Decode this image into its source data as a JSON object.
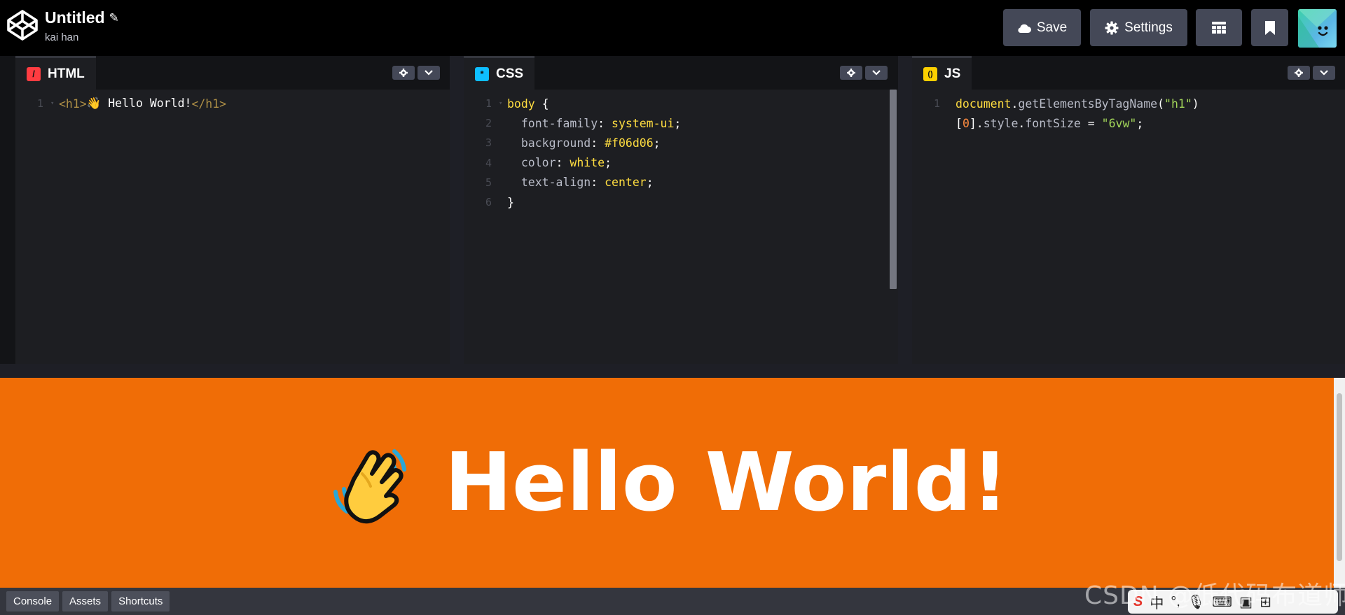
{
  "header": {
    "title": "Untitled",
    "author": "kai han",
    "save_label": "Save",
    "settings_label": "Settings"
  },
  "panes": [
    {
      "id": "html",
      "label": "HTML",
      "icon_char": "/",
      "icon_color": "#ff3c41",
      "lines": [
        {
          "n": "1",
          "fold": true,
          "tokens": [
            {
              "t": "<h1>",
              "c": "#ae8f46"
            },
            {
              "t": "👋 Hello World!",
              "c": "#ffffff"
            },
            {
              "t": "</h1>",
              "c": "#ae8f46"
            }
          ]
        }
      ]
    },
    {
      "id": "css",
      "label": "CSS",
      "icon_char": "*",
      "icon_color": "#0ebeff",
      "lines": [
        {
          "n": "1",
          "fold": true,
          "tokens": [
            {
              "t": "body ",
              "c": "#ffdd40"
            },
            {
              "t": "{",
              "c": "#ffffff"
            }
          ]
        },
        {
          "n": "2",
          "tokens": [
            {
              "t": "  font-family",
              "c": "#b9bcc8"
            },
            {
              "t": ": ",
              "c": "#ffffff"
            },
            {
              "t": "system-ui",
              "c": "#ffdd40"
            },
            {
              "t": ";",
              "c": "#ffffff"
            }
          ]
        },
        {
          "n": "3",
          "tokens": [
            {
              "t": "  background",
              "c": "#b9bcc8"
            },
            {
              "t": ": ",
              "c": "#ffffff"
            },
            {
              "t": "#f06d06",
              "c": "#ffdd40"
            },
            {
              "t": ";",
              "c": "#ffffff"
            }
          ]
        },
        {
          "n": "4",
          "tokens": [
            {
              "t": "  color",
              "c": "#b9bcc8"
            },
            {
              "t": ": ",
              "c": "#ffffff"
            },
            {
              "t": "white",
              "c": "#ffdd40"
            },
            {
              "t": ";",
              "c": "#ffffff"
            }
          ]
        },
        {
          "n": "5",
          "tokens": [
            {
              "t": "  text-align",
              "c": "#b9bcc8"
            },
            {
              "t": ": ",
              "c": "#ffffff"
            },
            {
              "t": "center",
              "c": "#ffdd40"
            },
            {
              "t": ";",
              "c": "#ffffff"
            }
          ]
        },
        {
          "n": "6",
          "tokens": [
            {
              "t": "}",
              "c": "#ffffff"
            }
          ]
        }
      ]
    },
    {
      "id": "js",
      "label": "JS",
      "icon_char": "()",
      "icon_color": "#fcd000",
      "lines": [
        {
          "n": "1",
          "tokens": [
            {
              "t": "document",
              "c": "#ffdd40"
            },
            {
              "t": ".",
              "c": "#ffffff"
            },
            {
              "t": "getElementsByTagName",
              "c": "#b9bcc8"
            },
            {
              "t": "(",
              "c": "#ffffff"
            },
            {
              "t": "\"h1\"",
              "c": "#a3d65a"
            },
            {
              "t": ")",
              "c": "#ffffff"
            }
          ]
        },
        {
          "n": "",
          "tokens": [
            {
              "t": "[",
              "c": "#ffffff"
            },
            {
              "t": "0",
              "c": "#ff8c40"
            },
            {
              "t": "].",
              "c": "#ffffff"
            },
            {
              "t": "style",
              "c": "#b9bcc8"
            },
            {
              "t": ".",
              "c": "#ffffff"
            },
            {
              "t": "fontSize",
              "c": "#b9bcc8"
            },
            {
              "t": " = ",
              "c": "#ffffff"
            },
            {
              "t": "\"6vw\"",
              "c": "#a3d65a"
            },
            {
              "t": ";",
              "c": "#ffffff"
            }
          ]
        }
      ]
    }
  ],
  "preview": {
    "heading": "Hello World!",
    "background": "#f06d06"
  },
  "footer": {
    "console_label": "Console",
    "assets_label": "Assets",
    "shortcuts_label": "Shortcuts"
  },
  "watermark": "CSDN @低代码布道师",
  "ime": {
    "s": "S",
    "lang": "中"
  }
}
